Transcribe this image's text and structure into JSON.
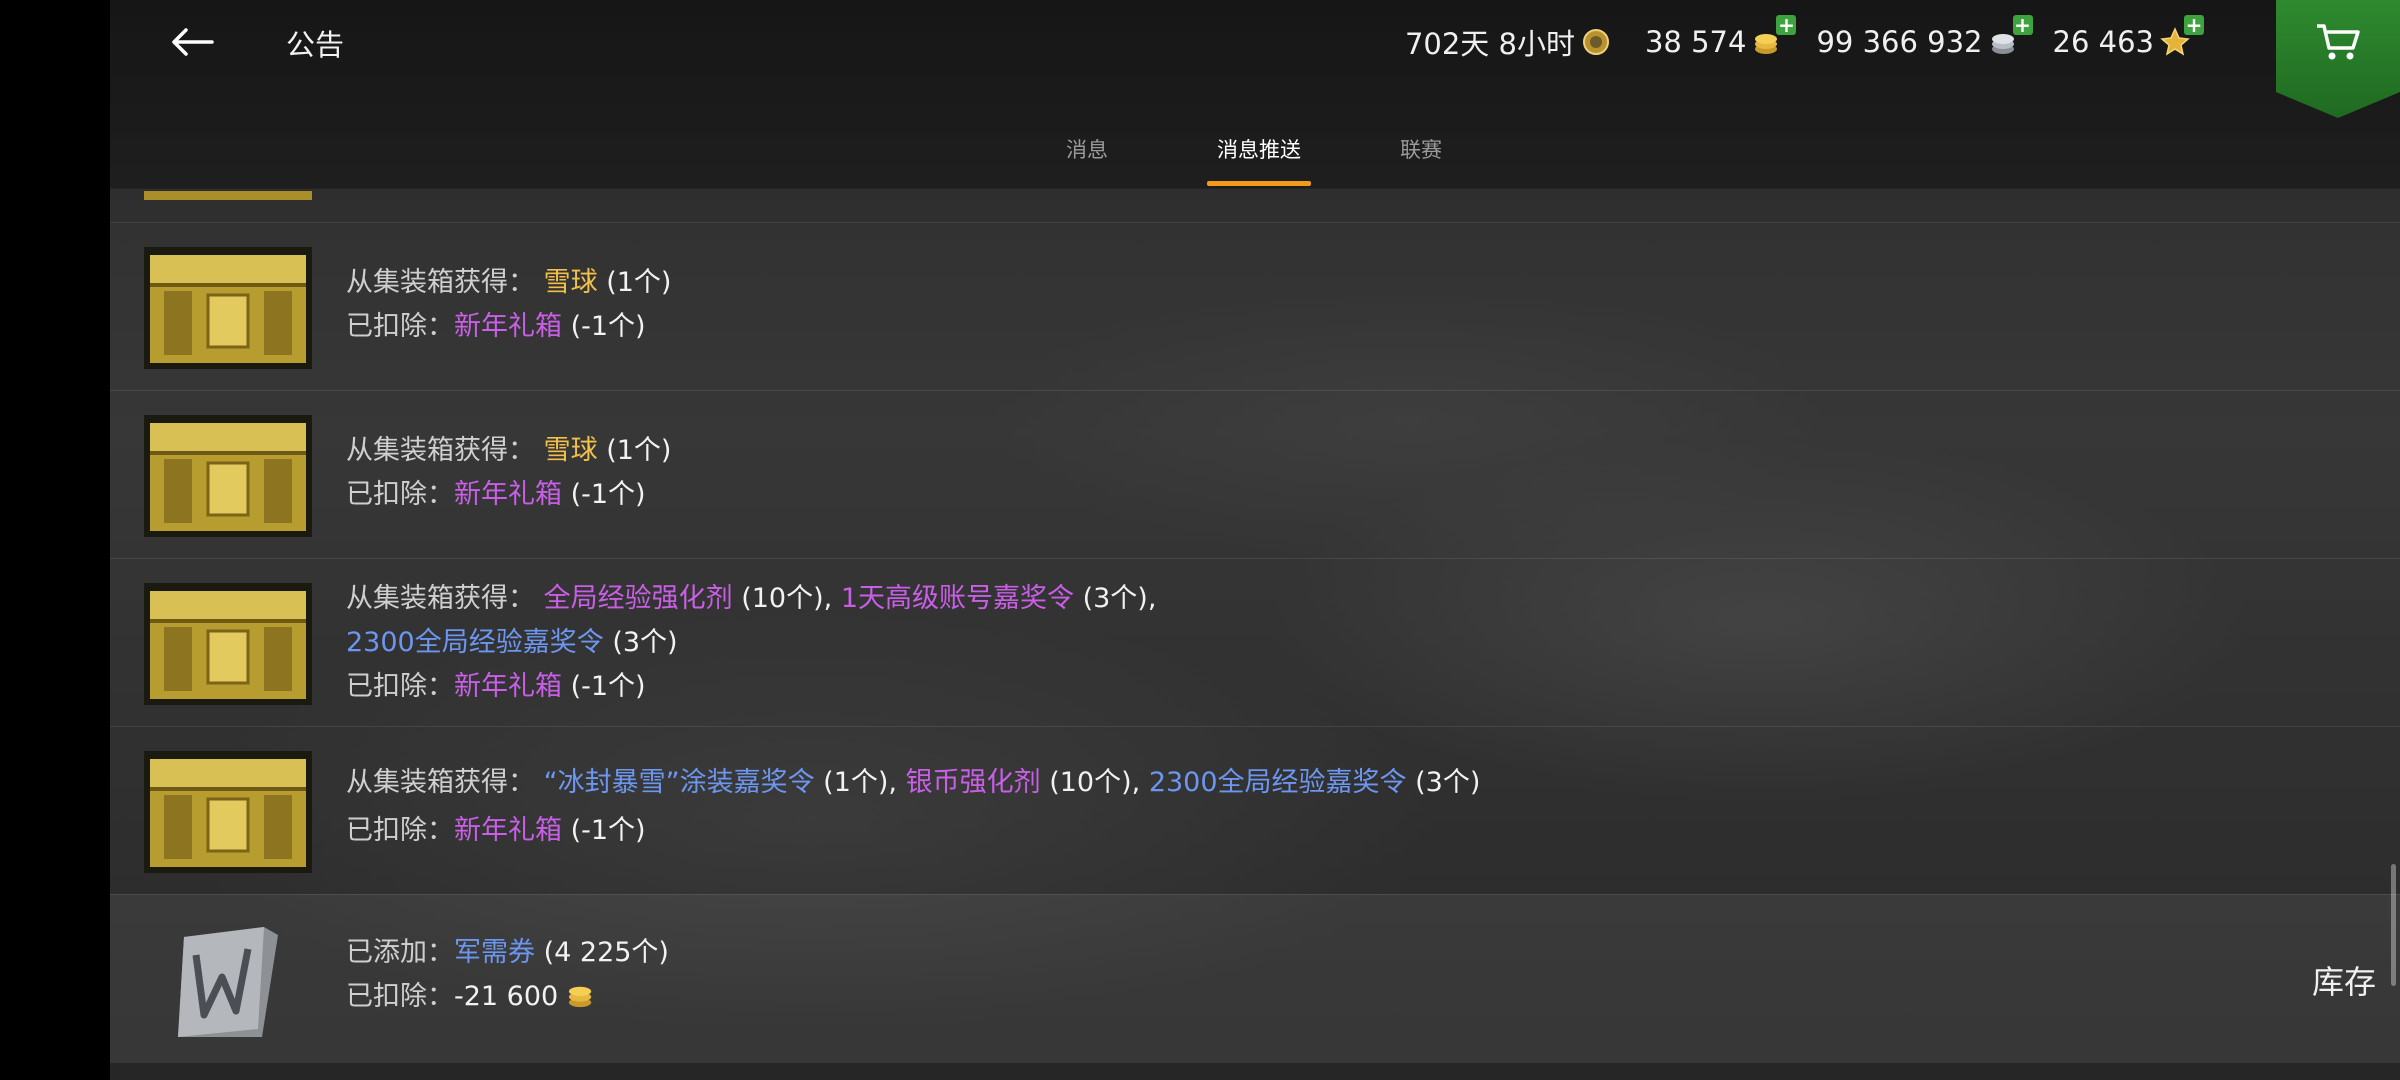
{
  "header": {
    "title": "公告",
    "premium_time": "702天 8小时",
    "gold": "38 574",
    "silver": "99 366 932",
    "stars": "26 463"
  },
  "tabs": [
    {
      "label": "消息"
    },
    {
      "label": "消息推送",
      "active": true
    },
    {
      "label": "联赛"
    }
  ],
  "colors": {
    "accent_tab": "#f29a1a",
    "item_gold": "#f0c04a",
    "item_purple": "#c95fe6",
    "item_blue": "#6c96ef",
    "cart_green": "#2f8a2f"
  },
  "messages": [
    {
      "from_label": "从集装箱获得：",
      "from_items": [
        {
          "name": "雪球",
          "qty": "(1个)"
        }
      ],
      "deduct_label": "已扣除：",
      "deduct_name": "新年礼箱",
      "deduct_qty": "(-1个)"
    },
    {
      "from_label": "从集装箱获得：",
      "from_items": [
        {
          "name": "雪球",
          "qty": "(1个)"
        }
      ],
      "deduct_label": "已扣除：",
      "deduct_name": "新年礼箱",
      "deduct_qty": "(-1个)"
    },
    {
      "from_label": "从集装箱获得：",
      "from_items": [
        {
          "name": "全局经验强化剂",
          "qty": "(10个)"
        },
        {
          "name": "1天高级账号嘉奖令",
          "qty": "(3个)"
        },
        {
          "name": "2300全局经验嘉奖令",
          "qty": "(3个)"
        }
      ],
      "deduct_label": "已扣除：",
      "deduct_name": "新年礼箱",
      "deduct_qty": "(-1个)"
    },
    {
      "from_label": "从集装箱获得：",
      "from_items": [
        {
          "name": "“冰封暴雪”涂装嘉奖令",
          "qty": "(1个)"
        },
        {
          "name": "银币强化剂",
          "qty": "(10个)"
        },
        {
          "name": "2300全局经验嘉奖令",
          "qty": "(3个)"
        }
      ],
      "deduct_label": "已扣除：",
      "deduct_name": "新年礼箱",
      "deduct_qty": "(-1个)"
    },
    {
      "add_label": "已添加：",
      "add_name": "军需券",
      "add_qty": "(4 225个)",
      "deduct_label": "已扣除：",
      "deduct_amount": "-21 600",
      "action": "库存"
    }
  ],
  "separator": ","
}
